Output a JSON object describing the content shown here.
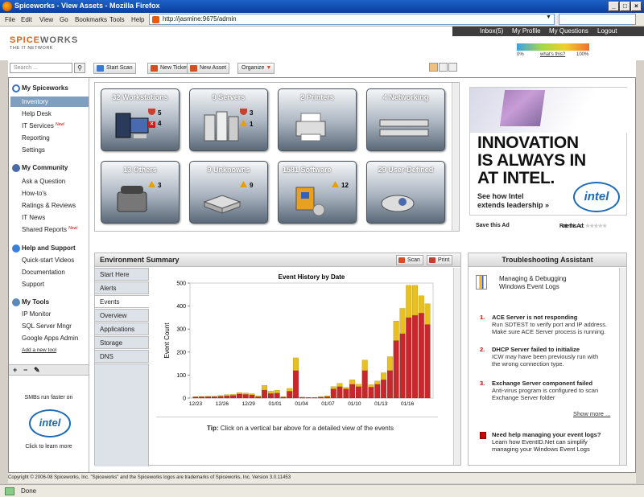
{
  "window": {
    "title": "Spiceworks - View Assets - Mozilla Firefox"
  },
  "menu": [
    "File",
    "Edit",
    "View",
    "Go",
    "Bookmarks",
    "Tools",
    "Help"
  ],
  "url": "http://jasmine:9675/admin",
  "logo": {
    "brand_a": "SPICE",
    "brand_b": "WORKS",
    "tagline": "THE IT NETWORK"
  },
  "toplinks": [
    "Inbox(5)",
    "My Profile",
    "My Questions",
    "Logout"
  ],
  "meter": {
    "min": "0%",
    "link": "what's this?",
    "max": "100%"
  },
  "toolbar": {
    "search_placeholder": "Search ...",
    "buttons": [
      "Start Scan",
      "New Ticket",
      "New Asset"
    ],
    "organize": "Organize"
  },
  "sidebar": {
    "sections": [
      {
        "title": "My Spiceworks",
        "items": [
          "Inventory",
          "Help Desk",
          "IT Services",
          "Reporting",
          "Settings"
        ]
      },
      {
        "title": "My Community",
        "items": [
          "Ask a Question",
          "How-to's",
          "Ratings & Reviews",
          "IT News",
          "Shared Reports"
        ]
      },
      {
        "title": "Help and Support",
        "items": [
          "Quick-start Videos",
          "Documentation",
          "Support"
        ]
      },
      {
        "title": "My Tools",
        "items": [
          "IP Monitor",
          "SQL Server Mngr",
          "Google Apps Admin"
        ]
      }
    ],
    "new_label": "New!",
    "add_tool": "Add a new tool",
    "smb_text": "SMBs run faster on",
    "intel": "intel",
    "learn": "Click to learn more"
  },
  "tiles": [
    {
      "title": "32 Workstations",
      "badges": [
        {
          "kind": "shield",
          "value": "5"
        },
        {
          "kind": "error",
          "value": "4"
        }
      ]
    },
    {
      "title": "9 Servers",
      "badges": [
        {
          "kind": "shield",
          "value": "3"
        },
        {
          "kind": "warn",
          "value": "1"
        }
      ]
    },
    {
      "title": "2 Printers",
      "badges": []
    },
    {
      "title": "4 Networking",
      "badges": []
    },
    {
      "title": "13 Others",
      "badges": [
        {
          "kind": "warn",
          "value": "3"
        }
      ]
    },
    {
      "title": "9 Unknowns",
      "badges": [
        {
          "kind": "warn",
          "value": "9"
        }
      ]
    },
    {
      "title": "1581 Software",
      "badges": [
        {
          "kind": "warn",
          "value": "12"
        }
      ]
    },
    {
      "title": "29 User-Defined",
      "badges": []
    }
  ],
  "ad": {
    "headline_1": "INNOVATION",
    "headline_2": "IS ALWAYS IN",
    "headline_3": "AT INTEL.",
    "sub_1": "See how Intel",
    "sub_2": "extends leadership »",
    "logo": "intel",
    "save": "Save this Ad",
    "rate": "Rate this Ad:",
    "stars": "★★★★★"
  },
  "env": {
    "title": "Environment Summary",
    "scan": "Scan",
    "print": "Print",
    "tabs": [
      "Start Here",
      "Alerts",
      "Events",
      "Overview",
      "Applications",
      "Storage",
      "DNS"
    ],
    "tip_label": "Tip:",
    "tip": "Click on a vertical bar above for a detailed view of the events"
  },
  "chart_data": {
    "type": "bar",
    "title": "Event History by Date",
    "ylabel": "Event Count",
    "xlabel": "",
    "ylim": [
      0,
      500
    ],
    "yticks": [
      0,
      100,
      200,
      300,
      400,
      500
    ],
    "xtick_labels": [
      "12/23",
      "12/26",
      "12/29",
      "01/01",
      "01/04",
      "01/07",
      "01/10",
      "01/13",
      "01/16"
    ],
    "stacked": true,
    "colors": {
      "lower": "#c8282c",
      "upper": "#e8c020"
    },
    "series": [
      {
        "values": [
          5,
          6,
          6,
          6,
          8,
          10,
          12,
          18,
          16,
          14,
          6,
          35,
          20,
          22,
          4,
          30,
          120,
          3,
          2,
          2,
          4,
          6,
          40,
          50,
          40,
          60,
          50,
          120,
          48,
          60,
          80,
          120,
          250,
          280,
          350,
          360,
          370,
          320
        ]
      },
      {
        "values": [
          1,
          1,
          2,
          2,
          3,
          5,
          4,
          6,
          6,
          5,
          3,
          20,
          10,
          12,
          2,
          12,
          55,
          1,
          1,
          1,
          2,
          4,
          10,
          14,
          6,
          20,
          10,
          45,
          10,
          14,
          30,
          60,
          85,
          110,
          140,
          130,
          75,
          90
        ]
      }
    ]
  },
  "trouble": {
    "title": "Troubleshooting Assistant",
    "doc_title_1": "Managing & Debugging",
    "doc_title_2": "Windows Event Logs",
    "items": [
      {
        "n": "1.",
        "title": "ACE Server is not responding",
        "d1": "Run SDTEST to verify port and IP address.",
        "d2": "Make sure ACE Server process is running."
      },
      {
        "n": "2.",
        "title": "DHCP Server failed to initialize",
        "d1": "ICW may have been previously run with",
        "d2": "the wrong connection type."
      },
      {
        "n": "3.",
        "title": "Exchange Server component failed",
        "d1": "Anti-virus program is configured to scan",
        "d2": "Exchange Server folder"
      }
    ],
    "show_more": "Show more ...",
    "help_title": "Need help managing your event logs?",
    "help_1": "Learn how EventID.Net can simplify",
    "help_2": "managing your Windows Event Logs"
  },
  "footer": "Copyright © 2006-08 Spiceworks, Inc. \"Spiceworks\" and the Spiceworks logos are trademarks of Spiceworks, Inc. Version 3.0.11453",
  "status": "Done"
}
